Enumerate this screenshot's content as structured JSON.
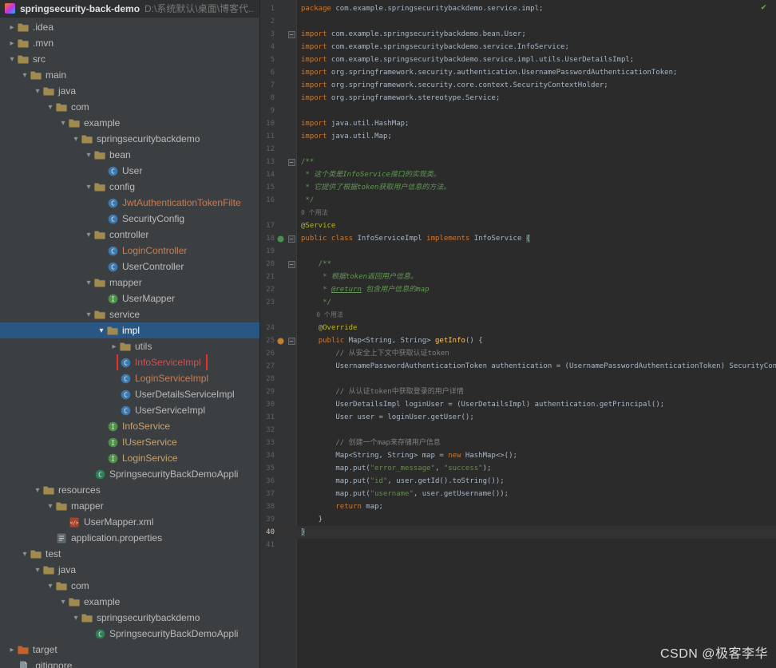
{
  "header": {
    "project_name": "springsecurity-back-demo",
    "project_path": "D:\\系统默认\\桌面\\博客代..."
  },
  "watermark": "CSDN @极客李华",
  "colors": {
    "selection_bg": "#2a5684",
    "red_marker": "#e8302e",
    "inspection_check": "#62b543",
    "keyword": "#cc7832",
    "plain": "#a9b7c6",
    "string": "#6a8759",
    "comment": "#808080",
    "doc_comment": "#629755",
    "annotation": "#bbb529",
    "method_decl": "#ffc66d",
    "inlay_hint": "#787878",
    "brace_match_bg": "#3b514d",
    "line_number": "#606366",
    "editor_bg": "#2b2b2b",
    "panel_bg": "#3c3f41",
    "gutter_bg": "#313335"
  },
  "tree": {
    "items": [
      {
        "label": ".idea",
        "depth": 1,
        "icon": "folder",
        "chevron": "collapsed"
      },
      {
        "label": ".mvn",
        "depth": 1,
        "icon": "folder",
        "chevron": "collapsed"
      },
      {
        "label": "src",
        "depth": 1,
        "icon": "folder",
        "chevron": "expanded"
      },
      {
        "label": "main",
        "depth": 2,
        "icon": "folder",
        "chevron": "expanded"
      },
      {
        "label": "java",
        "depth": 3,
        "icon": "folder",
        "chevron": "expanded"
      },
      {
        "label": "com",
        "depth": 4,
        "icon": "folder",
        "chevron": "expanded"
      },
      {
        "label": "example",
        "depth": 5,
        "icon": "folder",
        "chevron": "expanded"
      },
      {
        "label": "springsecuritybackdemo",
        "depth": 6,
        "icon": "folder",
        "chevron": "expanded"
      },
      {
        "label": "bean",
        "depth": 7,
        "icon": "folder",
        "chevron": "expanded"
      },
      {
        "label": "User",
        "depth": 8,
        "icon": "class"
      },
      {
        "label": "config",
        "depth": 7,
        "icon": "folder",
        "chevron": "expanded"
      },
      {
        "label": "JwtAuthenticationTokenFilte",
        "depth": 8,
        "icon": "class",
        "color": "#c77d55"
      },
      {
        "label": "SecurityConfig",
        "depth": 8,
        "icon": "class"
      },
      {
        "label": "controller",
        "depth": 7,
        "icon": "folder",
        "chevron": "expanded"
      },
      {
        "label": "LoginController",
        "depth": 8,
        "icon": "class",
        "color": "#c77d55"
      },
      {
        "label": "UserController",
        "depth": 8,
        "icon": "class"
      },
      {
        "label": "mapper",
        "depth": 7,
        "icon": "folder",
        "chevron": "expanded"
      },
      {
        "label": "UserMapper",
        "depth": 8,
        "icon": "interface"
      },
      {
        "label": "service",
        "depth": 7,
        "icon": "folder",
        "chevron": "expanded"
      },
      {
        "label": "impl",
        "depth": 8,
        "icon": "folder",
        "chevron": "expanded",
        "selected": true
      },
      {
        "label": "utils",
        "depth": 9,
        "icon": "folder",
        "chevron": "collapsed"
      },
      {
        "label": "InfoServiceImpl",
        "depth": 9,
        "icon": "class",
        "color": "#d05050",
        "marked": true
      },
      {
        "label": "LoginServiceImpl",
        "depth": 9,
        "icon": "class",
        "color": "#c77d55"
      },
      {
        "label": "UserDetailsServiceImpl",
        "depth": 9,
        "icon": "class"
      },
      {
        "label": "UserServiceImpl",
        "depth": 9,
        "icon": "class"
      },
      {
        "label": "InfoService",
        "depth": 8,
        "icon": "interface",
        "color": "#c9a36b"
      },
      {
        "label": "IUserService",
        "depth": 8,
        "icon": "interface",
        "color": "#c9a36b"
      },
      {
        "label": "LoginService",
        "depth": 8,
        "icon": "interface",
        "color": "#c9a36b"
      },
      {
        "label": "SpringsecurityBackDemoAppli",
        "depth": 7,
        "icon": "boot-class"
      },
      {
        "label": "resources",
        "depth": 3,
        "icon": "folder",
        "chevron": "expanded"
      },
      {
        "label": "mapper",
        "depth": 4,
        "icon": "folder",
        "chevron": "expanded"
      },
      {
        "label": "UserMapper.xml",
        "depth": 5,
        "icon": "xml-file"
      },
      {
        "label": "application.properties",
        "depth": 4,
        "icon": "properties-file"
      },
      {
        "label": "test",
        "depth": 2,
        "icon": "folder",
        "chevron": "expanded"
      },
      {
        "label": "java",
        "depth": 3,
        "icon": "folder",
        "chevron": "expanded"
      },
      {
        "label": "com",
        "depth": 4,
        "icon": "folder",
        "chevron": "expanded"
      },
      {
        "label": "example",
        "depth": 5,
        "icon": "folder",
        "chevron": "expanded"
      },
      {
        "label": "springsecuritybackdemo",
        "depth": 6,
        "icon": "folder",
        "chevron": "expanded"
      },
      {
        "label": "SpringsecurityBackDemoAppli",
        "depth": 7,
        "icon": "boot-class"
      },
      {
        "label": "target",
        "depth": 1,
        "icon": "folder-excluded",
        "chevron": "collapsed"
      },
      {
        "label": ".gitignore",
        "depth": 1,
        "icon": "text-file"
      }
    ]
  },
  "editor": {
    "lines": [
      {
        "n": 1,
        "tk": [
          [
            "kw",
            "package"
          ],
          [
            "pl",
            " com.example.springsecuritybackdemo.service.impl;"
          ]
        ]
      },
      {
        "n": 2,
        "tk": []
      },
      {
        "n": 3,
        "f": true,
        "tk": [
          [
            "kw",
            "import"
          ],
          [
            "pl",
            " com.example.springsecuritybackdemo.bean.User;"
          ]
        ]
      },
      {
        "n": 4,
        "tk": [
          [
            "kw",
            "import"
          ],
          [
            "pl",
            " com.example.springsecuritybackdemo.service.InfoService;"
          ]
        ]
      },
      {
        "n": 5,
        "tk": [
          [
            "kw",
            "import"
          ],
          [
            "pl",
            " com.example.springsecuritybackdemo.service.impl.utils.UserDetailsImpl;"
          ]
        ]
      },
      {
        "n": 6,
        "tk": [
          [
            "kw",
            "import"
          ],
          [
            "pl",
            " org.springframework.security.authentication.UsernamePasswordAuthenticationToken;"
          ]
        ]
      },
      {
        "n": 7,
        "tk": [
          [
            "kw",
            "import"
          ],
          [
            "pl",
            " org.springframework.security.core.context.SecurityContextHolder;"
          ]
        ]
      },
      {
        "n": 8,
        "tk": [
          [
            "kw",
            "import"
          ],
          [
            "pl",
            " org.springframework.stereotype.Service;"
          ]
        ]
      },
      {
        "n": 9,
        "tk": []
      },
      {
        "n": 10,
        "tk": [
          [
            "kw",
            "import"
          ],
          [
            "pl",
            " java.util.HashMap;"
          ]
        ]
      },
      {
        "n": 11,
        "tk": [
          [
            "kw",
            "import"
          ],
          [
            "pl",
            " java.util.Map;"
          ]
        ]
      },
      {
        "n": 12,
        "tk": []
      },
      {
        "n": 13,
        "f": true,
        "tk": [
          [
            "doc",
            "/**"
          ]
        ]
      },
      {
        "n": 14,
        "tk": [
          [
            "doc",
            " * "
          ],
          [
            "doci",
            "这个类是InfoService接口的实现类。"
          ]
        ]
      },
      {
        "n": 15,
        "tk": [
          [
            "doc",
            " * "
          ],
          [
            "doci",
            "它提供了根据token获取用户信息的方法。"
          ]
        ]
      },
      {
        "n": 16,
        "tk": [
          [
            "doc",
            " */"
          ]
        ]
      },
      {
        "n": null,
        "tk": [
          [
            "hint",
            "0 个用法"
          ]
        ]
      },
      {
        "n": 17,
        "tk": [
          [
            "ann",
            "@Service"
          ]
        ]
      },
      {
        "n": 18,
        "f": true,
        "m": "implements",
        "tk": [
          [
            "kw",
            "public class "
          ],
          [
            "pl",
            "InfoServiceImpl "
          ],
          [
            "kw",
            "implements"
          ],
          [
            "pl",
            " InfoService "
          ],
          [
            "match",
            "{"
          ]
        ]
      },
      {
        "n": 19,
        "tk": []
      },
      {
        "n": 20,
        "f": true,
        "tk": [
          [
            "doc",
            "    /**"
          ]
        ]
      },
      {
        "n": 21,
        "tk": [
          [
            "doc",
            "     * "
          ],
          [
            "doci",
            "根据token返回用户信息。"
          ]
        ]
      },
      {
        "n": 22,
        "tk": [
          [
            "doc",
            "     * "
          ],
          [
            "doctag",
            "@return"
          ],
          [
            "doci",
            " 包含用户信息的map"
          ]
        ]
      },
      {
        "n": 23,
        "tk": [
          [
            "doc",
            "     */"
          ]
        ]
      },
      {
        "n": null,
        "tk": [
          [
            "hint",
            "    0 个用法"
          ]
        ]
      },
      {
        "n": 24,
        "tk": [
          [
            "pl",
            "    "
          ],
          [
            "ann",
            "@Override"
          ]
        ]
      },
      {
        "n": 25,
        "f": true,
        "m": "overrides",
        "tk": [
          [
            "pl",
            "    "
          ],
          [
            "kw",
            "public "
          ],
          [
            "pl",
            "Map<String, String> "
          ],
          [
            "method",
            "getInfo"
          ],
          [
            "pl",
            "() {"
          ]
        ]
      },
      {
        "n": 26,
        "tk": [
          [
            "pl",
            "        "
          ],
          [
            "cmt",
            "// 从安全上下文中获取认证token"
          ]
        ]
      },
      {
        "n": 27,
        "tk": [
          [
            "pl",
            "        UsernamePasswordAuthenticationToken authentication = (UsernamePasswordAuthenticationToken) SecurityContextHolder"
          ]
        ]
      },
      {
        "n": 28,
        "tk": []
      },
      {
        "n": 29,
        "tk": [
          [
            "pl",
            "        "
          ],
          [
            "cmt",
            "// 从认证token中获取登录的用户详情"
          ]
        ]
      },
      {
        "n": 30,
        "tk": [
          [
            "pl",
            "        UserDetailsImpl loginUser = (UserDetailsImpl) authentication.getPrincipal();"
          ]
        ]
      },
      {
        "n": 31,
        "tk": [
          [
            "pl",
            "        User user = loginUser.getUser();"
          ]
        ]
      },
      {
        "n": 32,
        "tk": []
      },
      {
        "n": 33,
        "tk": [
          [
            "pl",
            "        "
          ],
          [
            "cmt",
            "// 创建一个map来存储用户信息"
          ]
        ]
      },
      {
        "n": 34,
        "tk": [
          [
            "pl",
            "        Map<String, String> map = "
          ],
          [
            "kw",
            "new"
          ],
          [
            "pl",
            " HashMap<>();"
          ]
        ]
      },
      {
        "n": 35,
        "tk": [
          [
            "pl",
            "        map.put("
          ],
          [
            "str",
            "\"error_message\""
          ],
          [
            "pl",
            ", "
          ],
          [
            "str",
            "\"success\""
          ],
          [
            "pl",
            ");"
          ]
        ]
      },
      {
        "n": 36,
        "tk": [
          [
            "pl",
            "        map.put("
          ],
          [
            "str",
            "\"id\""
          ],
          [
            "pl",
            ", user.getId().toString());"
          ]
        ]
      },
      {
        "n": 37,
        "tk": [
          [
            "pl",
            "        map.put("
          ],
          [
            "str",
            "\"username\""
          ],
          [
            "pl",
            ", user.getUsername());"
          ]
        ]
      },
      {
        "n": 38,
        "tk": [
          [
            "pl",
            "        "
          ],
          [
            "kw",
            "return"
          ],
          [
            "pl",
            " map;"
          ]
        ]
      },
      {
        "n": 39,
        "tk": [
          [
            "pl",
            "    }"
          ]
        ]
      },
      {
        "n": 40,
        "cur": true,
        "tk": [
          [
            "match",
            "}"
          ]
        ]
      },
      {
        "n": 41,
        "tk": []
      }
    ]
  }
}
